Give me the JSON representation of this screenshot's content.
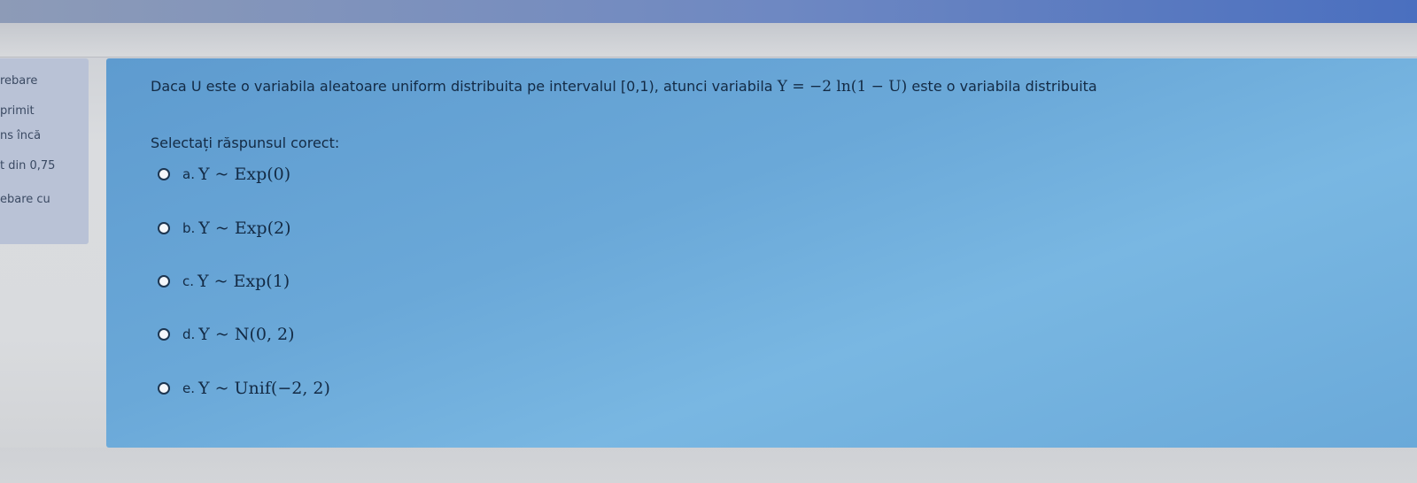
{
  "sidebar_info": {
    "lines": [
      "rebare",
      "primit",
      "ns încă",
      "t din 0,75",
      "ebare cu"
    ]
  },
  "question": {
    "text_before": "Daca U este o variabila aleatoare uniform distribuita pe intervalul [0,1), atunci variabila",
    "formula": "Y = −2 ln(1 − U)",
    "text_after": "este o variabila distribuita",
    "prompt": "Selectați răspunsul corect:"
  },
  "options": [
    {
      "letter": "a.",
      "expr": "Y ~ Exp(0)"
    },
    {
      "letter": "b.",
      "expr": "Y ~ Exp(2)"
    },
    {
      "letter": "c.",
      "expr": "Y ~ Exp(1)"
    },
    {
      "letter": "d.",
      "expr": "Y ~ N(0, 2)"
    },
    {
      "letter": "e.",
      "expr": "Y ~ Unif(−2, 2)"
    }
  ],
  "colors": {
    "content_bg": "#6aa8d8",
    "text": "#132a44",
    "info_panel_bg": "#b9c2d6"
  }
}
